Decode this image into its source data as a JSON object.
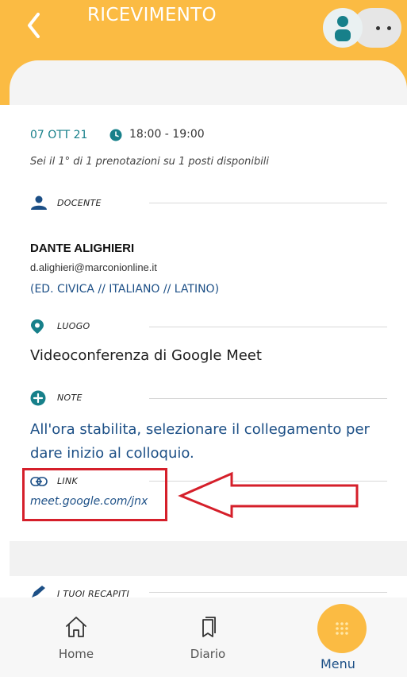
{
  "header": {
    "title": "RICEVIMENTO"
  },
  "appointment": {
    "date": "07 OTT 21",
    "time": "18:00 - 19:00",
    "booking_info": "Sei il 1° di 1 prenotazioni su 1 posti disponibili"
  },
  "docente": {
    "label": "DOCENTE",
    "name": "DANTE ALIGHIERI",
    "email": "d.alighieri@marconionline.it",
    "subjects": "(ED. CIVICA // ITALIANO // LATINO)"
  },
  "luogo": {
    "label": "LUOGO",
    "value": "Videoconferenza di Google Meet"
  },
  "note": {
    "label": "NOTE",
    "value": "All'ora stabilita, selezionare il collegamento per dare inizio al colloquio."
  },
  "link": {
    "label": "LINK",
    "value": "meet.google.com/jnx"
  },
  "recapiti": {
    "label": "I TUOI RECAPITI"
  },
  "bottom_nav": {
    "home": "Home",
    "diario": "Diario",
    "menu": "Menu"
  },
  "colors": {
    "accent": "#fbbb43",
    "teal": "#17808a",
    "blue_text": "#1c4f86",
    "highlight_red": "#d51f2a"
  },
  "icons": {
    "back": "chevron-left-icon",
    "avatar": "user-avatar-icon",
    "more": "more-dots-icon",
    "clock": "clock-icon",
    "docente": "person-icon",
    "luogo": "location-pin-icon",
    "note": "plus-circle-icon",
    "link": "link-icon",
    "recapiti": "pencil-icon",
    "home": "home-icon",
    "diario": "bookmarks-icon",
    "menu": "grid-dots-icon"
  }
}
